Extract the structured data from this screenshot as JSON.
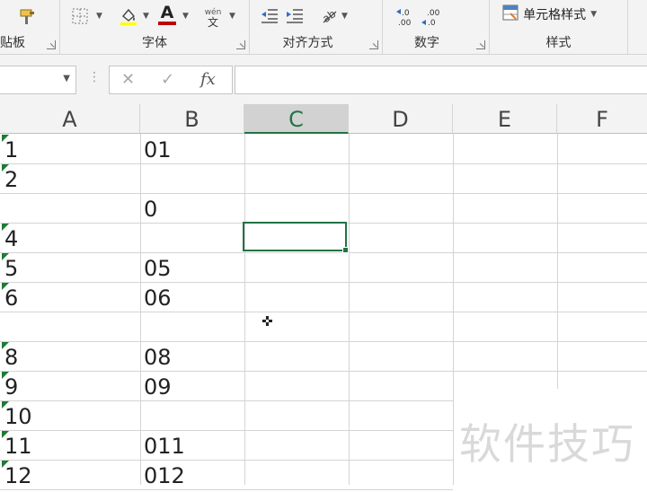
{
  "ribbon": {
    "groups": [
      {
        "label": "粘贴板"
      },
      {
        "label": "字体"
      },
      {
        "label": "对齐方式"
      },
      {
        "label": "数字"
      },
      {
        "label": "样式"
      }
    ],
    "style_button_label": "单元格样式",
    "phonetic_top": "wén",
    "phonetic_bottom": "文",
    "font_color_letter": "A"
  },
  "formula_bar": {
    "name_box_value": "",
    "cancel_symbol": "✕",
    "enter_symbol": "✓",
    "fx_label": "fx",
    "content": ""
  },
  "columns": [
    "A",
    "B",
    "C",
    "D",
    "E",
    "F"
  ],
  "selected_column": "C",
  "rows": [
    {
      "a": "1",
      "b": "01",
      "flag": true
    },
    {
      "a": "2",
      "b": "",
      "flag": true
    },
    {
      "a": "",
      "b": "0",
      "flag": false
    },
    {
      "a": "4",
      "b": "",
      "flag": true
    },
    {
      "a": "5",
      "b": "05",
      "flag": true
    },
    {
      "a": "6",
      "b": "06",
      "flag": true
    },
    {
      "a": "",
      "b": "",
      "flag": false
    },
    {
      "a": "8",
      "b": "08",
      "flag": true
    },
    {
      "a": "9",
      "b": "09",
      "flag": true
    },
    {
      "a": "10",
      "b": "",
      "flag": true
    },
    {
      "a": "11",
      "b": "011",
      "flag": true
    },
    {
      "a": "12",
      "b": "012",
      "flag": true
    }
  ],
  "watermark": "软件技巧",
  "colors": {
    "accent": "#217346",
    "error_triangle": "#1e7b34",
    "font_color_bar": "#c00000"
  }
}
